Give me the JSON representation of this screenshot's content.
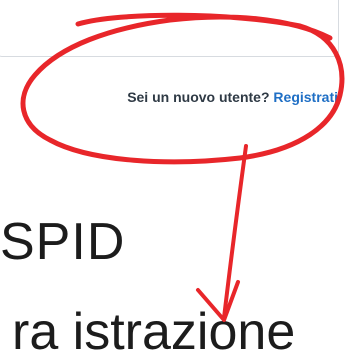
{
  "signup": {
    "prompt": "Sei un nuovo utente?",
    "link_label": "Registrati"
  },
  "background_text": {
    "line1": "SPID",
    "line2": "ra      istrazione"
  },
  "annotation": {
    "color": "#e8262a",
    "shapes": [
      "circle-stroke",
      "arrow-down"
    ]
  }
}
